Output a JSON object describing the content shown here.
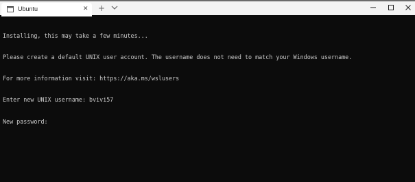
{
  "tab": {
    "title": "Ubuntu",
    "close_glyph": "✕"
  },
  "tabbar": {
    "new_tab_glyph": "+"
  },
  "terminal": {
    "lines": [
      "Installing, this may take a few minutes...",
      "Please create a default UNIX user account. The username does not need to match your Windows username.",
      "For more information visit: https://aka.ms/wslusers",
      "Enter new UNIX username: bvivi57",
      "New password:"
    ]
  },
  "colors": {
    "terminal_bg": "#0c0c0c",
    "terminal_fg": "#cccccc",
    "tabbar_bg": "#f3f3f3"
  },
  "icons": [
    "terminal-icon",
    "close-icon",
    "plus-icon",
    "chevron-down-icon",
    "minimize-icon",
    "maximize-icon",
    "close-window-icon"
  ]
}
